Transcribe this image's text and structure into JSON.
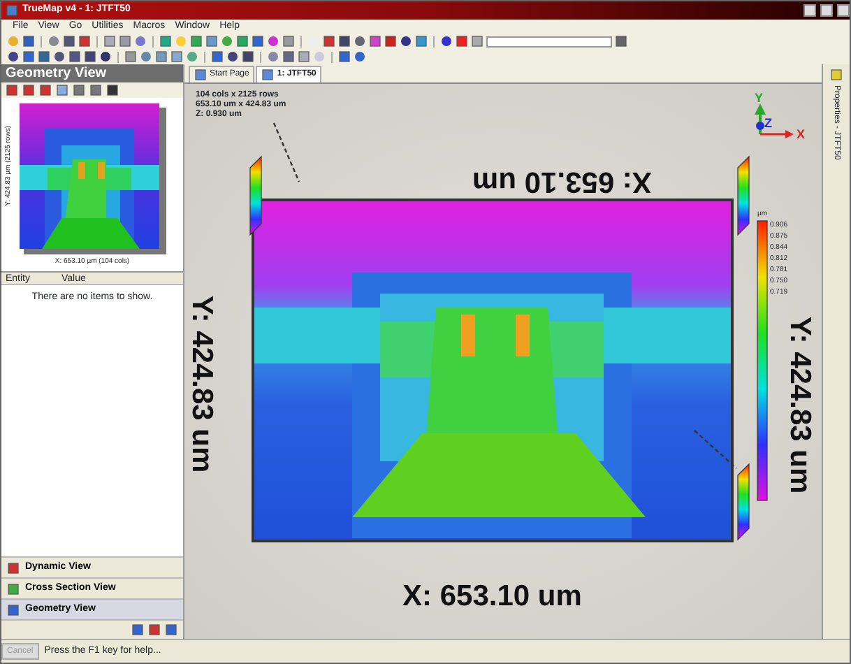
{
  "window": {
    "title": "TrueMap v4 - 1: JTFT50"
  },
  "menu": [
    "File",
    "View",
    "Go",
    "Utilities",
    "Macros",
    "Window",
    "Help"
  ],
  "left_panel": {
    "title": "Geometry View",
    "thumbnail": {
      "y_caption": "Y: 424.83 µm (2125 rows)",
      "x_caption": "X: 653.10 µm (104 cols)"
    },
    "grid": {
      "columns": [
        "Entity",
        "Value"
      ],
      "empty_message": "There are no items to show."
    },
    "views": [
      {
        "label": "Dynamic View",
        "selected": false
      },
      {
        "label": "Cross Section View",
        "selected": false
      },
      {
        "label": "Geometry View",
        "selected": true
      }
    ]
  },
  "tabs": [
    {
      "label": "Start Page",
      "selected": false
    },
    {
      "label": "1: JTFT50",
      "selected": true
    }
  ],
  "viewer": {
    "info": [
      "104 cols x 2125 rows",
      "653.10 um x 424.83 um",
      "Z: 0.930 um"
    ],
    "top_label": "X: 653.10 um",
    "left_label": "Y: 424.83 um",
    "right_label": "Y: 424.83 um",
    "bottom_label": "X: 653.10 um",
    "axes": {
      "x": "X",
      "y": "Y",
      "z": "Z"
    },
    "colorbar": {
      "unit": "µm",
      "ticks": [
        "0.906",
        "0.875",
        "0.844",
        "0.812",
        "0.781",
        "0.750",
        "0.719"
      ]
    }
  },
  "side_panel": {
    "label": "Properties - JTFT50"
  },
  "status_bar": {
    "button": "Cancel",
    "message": "Press the F1 key for help..."
  }
}
